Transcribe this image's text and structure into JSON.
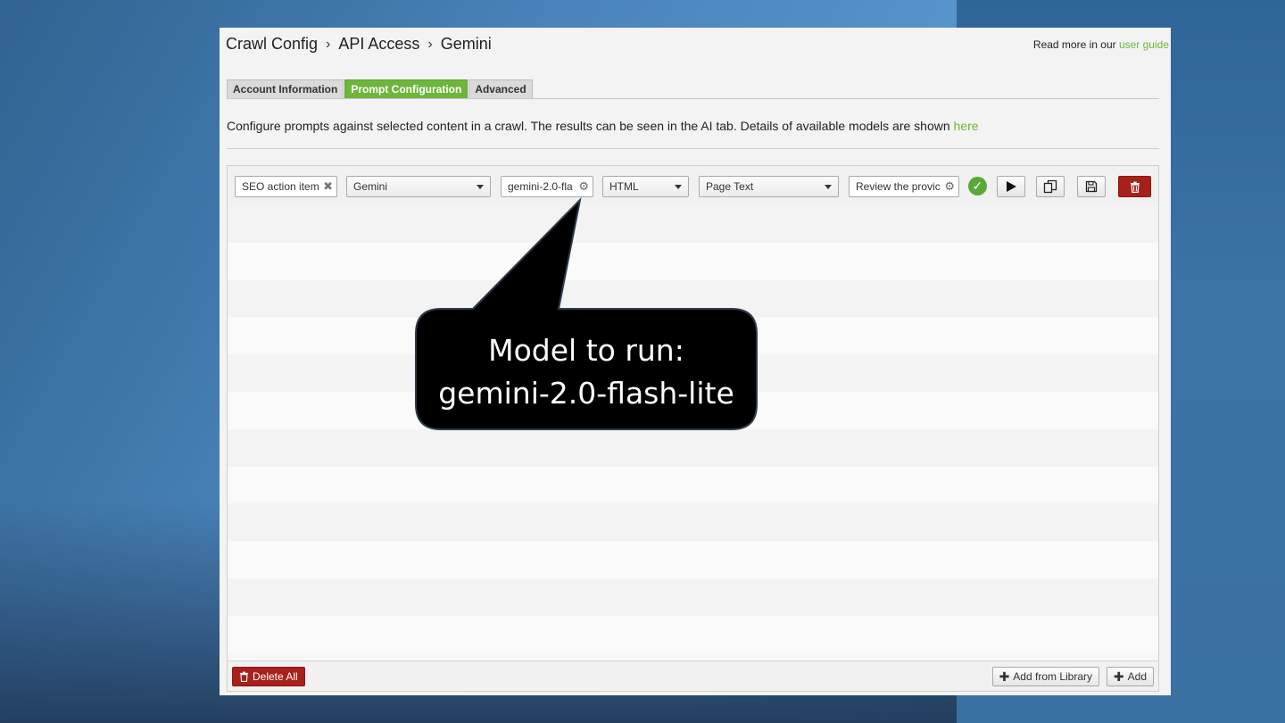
{
  "breadcrumb": [
    "Crawl Config",
    "API Access",
    "Gemini"
  ],
  "breadcrumb_sep": "›",
  "guide": {
    "prefix": "Read more in our ",
    "link": "user guide"
  },
  "tabs": [
    {
      "label": "Account Information",
      "active": false
    },
    {
      "label": "Prompt Configuration",
      "active": true
    },
    {
      "label": "Advanced",
      "active": false
    }
  ],
  "description": {
    "text": "Configure prompts against selected content in a crawl. The results can be seen in the AI tab. Details of available models are shown ",
    "link": "here"
  },
  "prompt_row": {
    "name": "SEO action item",
    "provider": "Gemini",
    "model": "gemini-2.0-fla",
    "format": "HTML",
    "content": "Page Text",
    "prompt": "Review the provic"
  },
  "footer": {
    "delete_all": "Delete All",
    "add_from_library": "Add from Library",
    "add": "Add"
  },
  "callout": {
    "line1": "Model to run:",
    "line2": "gemini-2.0-flash-lite"
  },
  "colors": {
    "accent_green": "#6cb63b",
    "danger_red": "#a8201a",
    "callout_bg": "#000000"
  }
}
